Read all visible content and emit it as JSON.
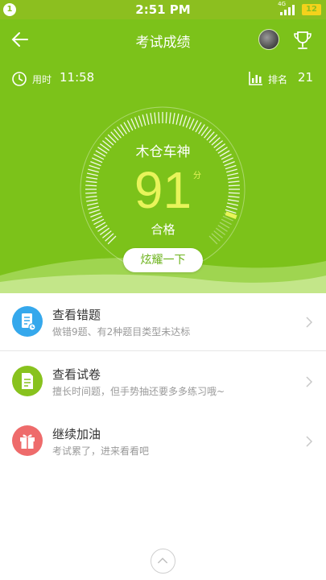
{
  "status_bar": {
    "notification_count": "1",
    "time": "2:51 PM",
    "network": "4G",
    "battery": "12"
  },
  "header": {
    "title": "考试成绩",
    "back_icon": "arrow-left-icon",
    "trophy_icon": "trophy-icon"
  },
  "stats": {
    "time_label": "用时",
    "time_value": "11:58",
    "rank_label": "排名",
    "rank_value": "21"
  },
  "result": {
    "user_name": "木仓车神",
    "score": "91",
    "score_unit": "分",
    "grade": "合格",
    "score_fraction": 0.91
  },
  "share_button": {
    "label": "炫耀一下"
  },
  "list": [
    {
      "title": "查看错题",
      "subtitle": "做错9题、有2种题目类型未达标",
      "icon": "wrong-questions-icon",
      "color": "#35a8ec"
    },
    {
      "title": "查看试卷",
      "subtitle": "擅长时间题，但手势抽还要多多练习哦~",
      "icon": "exam-paper-icon",
      "color": "#88c21e"
    },
    {
      "title": "继续加油",
      "subtitle": "考试累了，进来看看吧",
      "icon": "gift-icon",
      "color": "#ee6b6b"
    }
  ],
  "colors": {
    "hero_green": "#7cc21a",
    "status_green": "#8cbf1f",
    "score_yellow": "#e8f45a"
  },
  "bottom": {
    "up_icon": "chevron-up-icon"
  }
}
